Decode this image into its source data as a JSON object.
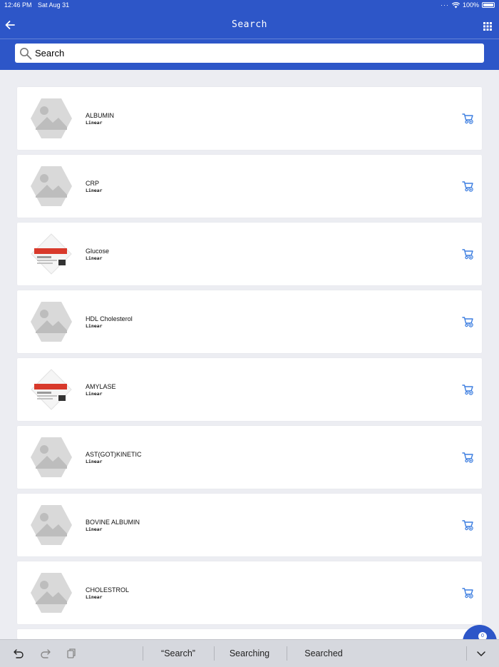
{
  "status_bar": {
    "time": "12:46 PM",
    "date": "Sat Aug 31",
    "battery": "100%"
  },
  "header": {
    "title": "Search"
  },
  "search": {
    "value": "Search"
  },
  "items": [
    {
      "name": "ALBUMIN",
      "sub": "Linear",
      "thumb": "placeholder-image"
    },
    {
      "name": "CRP",
      "sub": "Linear",
      "thumb": "placeholder-image"
    },
    {
      "name": "Glucose",
      "sub": "Linear",
      "thumb": "product-box-image"
    },
    {
      "name": "HDL Cholesterol",
      "sub": "Linear",
      "thumb": "placeholder-image"
    },
    {
      "name": "AMYLASE",
      "sub": "Linear",
      "thumb": "product-box-image"
    },
    {
      "name": "AST(GOT)KINETIC",
      "sub": "Linear",
      "thumb": "placeholder-image"
    },
    {
      "name": "BOVINE ALBUMIN",
      "sub": "Linear",
      "thumb": "placeholder-image"
    },
    {
      "name": "CHOLESTROL",
      "sub": "Linear",
      "thumb": "placeholder-image"
    }
  ],
  "fab": {
    "badge": "0"
  },
  "keyboard_bar": {
    "suggestions": [
      "“Search”",
      "Searching",
      "Searched"
    ]
  },
  "colors": {
    "primary": "#2d56c8",
    "accent_icon": "#3b7de0",
    "background": "#ecedf2"
  }
}
